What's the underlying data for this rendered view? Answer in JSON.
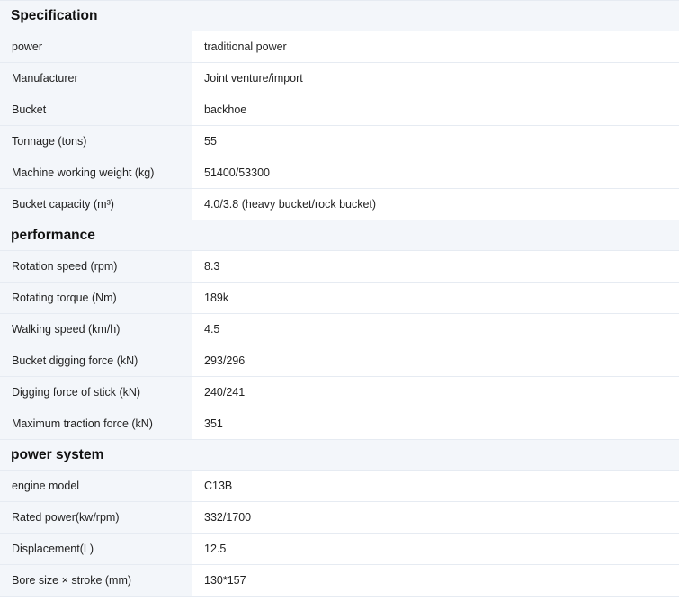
{
  "sections": [
    {
      "title": "Specification",
      "rows": [
        {
          "label": "power",
          "value": "traditional power"
        },
        {
          "label": "Manufacturer",
          "value": "Joint venture/import"
        },
        {
          "label": "Bucket",
          "value": "backhoe"
        },
        {
          "label": "Tonnage (tons)",
          "value": "55"
        },
        {
          "label": "Machine working weight (kg)",
          "value": "51400/53300"
        },
        {
          "label": "Bucket capacity (m³)",
          "value": "4.0/3.8 (heavy bucket/rock bucket)"
        }
      ]
    },
    {
      "title": "performance",
      "rows": [
        {
          "label": "Rotation speed (rpm)",
          "value": "8.3"
        },
        {
          "label": "Rotating torque (Nm)",
          "value": "189k"
        },
        {
          "label": "Walking speed (km/h)",
          "value": "4.5"
        },
        {
          "label": "Bucket digging force (kN)",
          "value": "293/296"
        },
        {
          "label": "Digging force of stick (kN)",
          "value": "240/241"
        },
        {
          "label": "Maximum traction force (kN)",
          "value": "351"
        }
      ]
    },
    {
      "title": "power system",
      "rows": [
        {
          "label": "engine model",
          "value": "C13B"
        },
        {
          "label": "Rated power(kw/rpm)",
          "value": "332/1700"
        },
        {
          "label": "Displacement(L)",
          "value": "12.5"
        },
        {
          "label": "Bore size × stroke (mm)",
          "value": "130*157"
        }
      ]
    }
  ]
}
